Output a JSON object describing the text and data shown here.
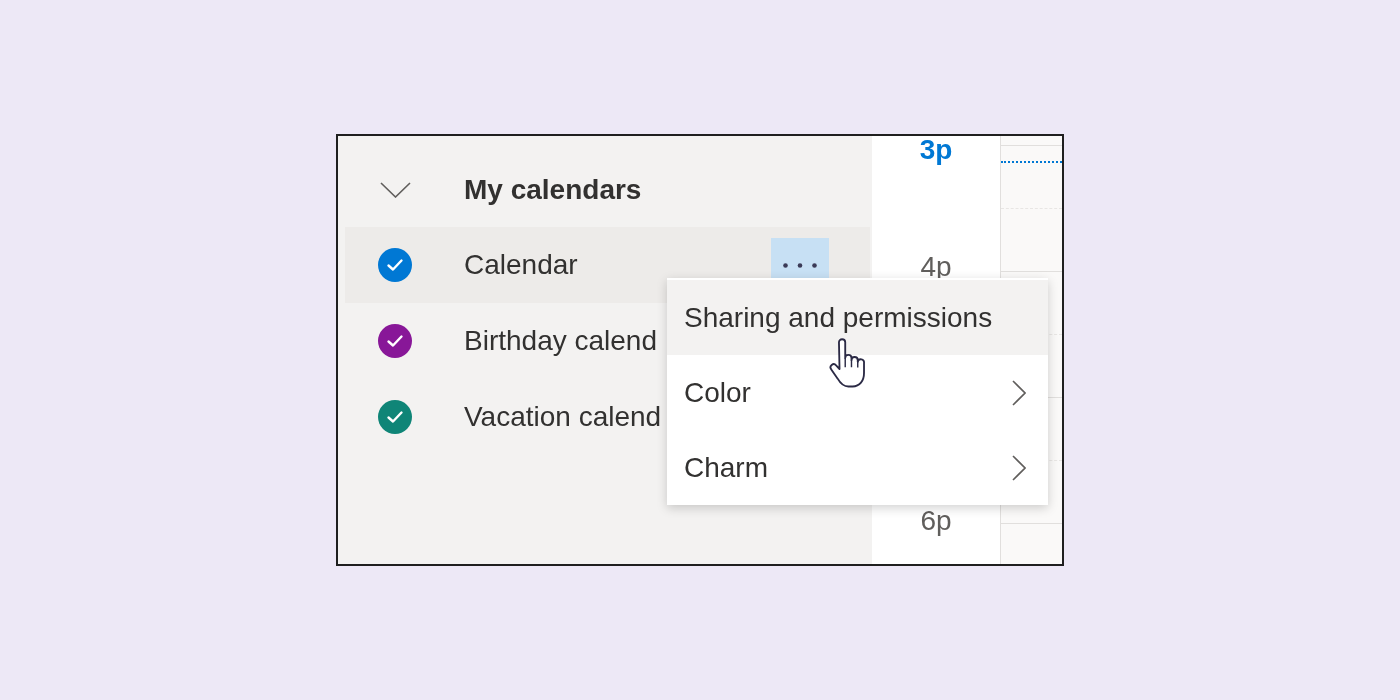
{
  "sidebar": {
    "section": {
      "title": "My calendars",
      "expanded": true
    },
    "calendars": [
      {
        "name": "Calendar",
        "color": "#0078d4",
        "checked": true,
        "selected": true
      },
      {
        "name": "Birthday calend",
        "color": "#881798",
        "checked": true,
        "selected": false
      },
      {
        "name": "Vacation calend",
        "color": "#0f8577",
        "checked": true,
        "selected": false
      }
    ]
  },
  "time_column": {
    "labels": [
      {
        "text": "3p",
        "current": true
      },
      {
        "text": "4p",
        "current": false
      },
      {
        "text": "6p",
        "current": false
      }
    ]
  },
  "context_menu": {
    "items": [
      {
        "label": "Sharing and permissions",
        "hovered": true,
        "submenu": false
      },
      {
        "label": "Color",
        "hovered": false,
        "submenu": true
      },
      {
        "label": "Charm",
        "hovered": false,
        "submenu": true
      }
    ]
  }
}
